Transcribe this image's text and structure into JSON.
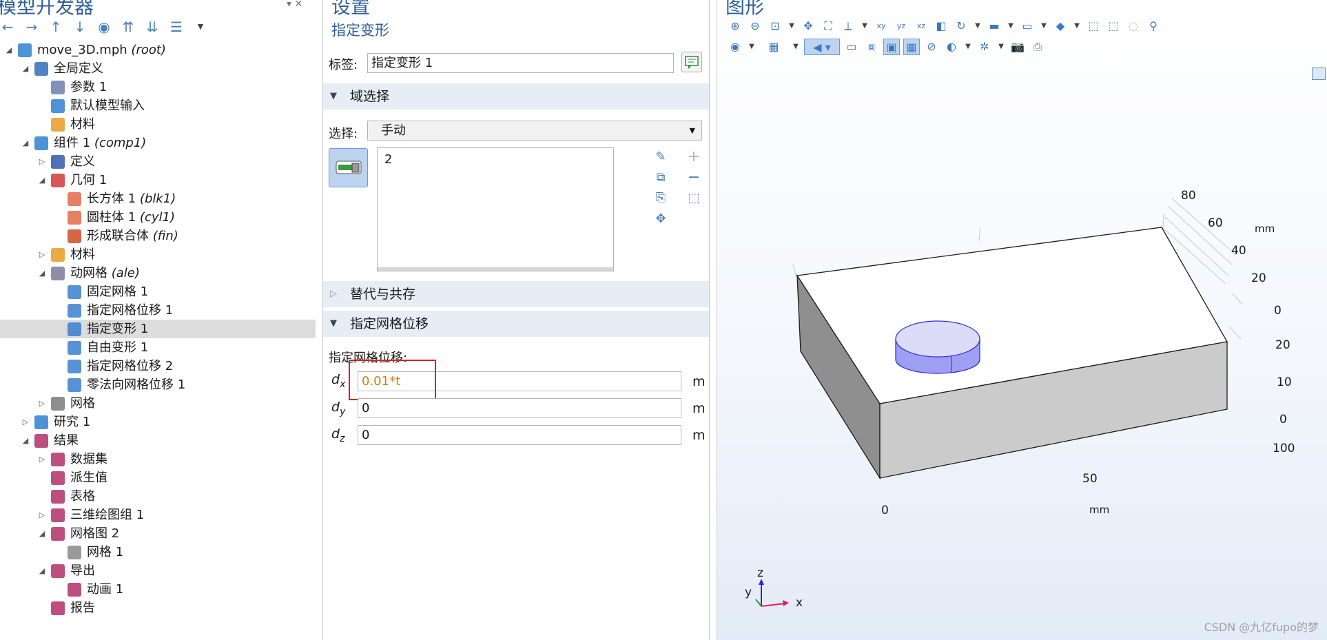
{
  "model_builder": {
    "title": "模型开发器",
    "toolbar_icons": [
      "arrow-left-icon",
      "arrow-right-icon",
      "arrow-up-icon",
      "arrow-down-icon",
      "eye-icon",
      "sort-up-icon",
      "sort-down-icon",
      "list-icon"
    ],
    "tree": [
      {
        "label": "move_3D.mph",
        "tag": "(root)",
        "level": 0,
        "toggle": "expanded",
        "icon": "root-file-icon"
      },
      {
        "label": "全局定义",
        "tag": "",
        "level": 1,
        "toggle": "expanded",
        "icon": "globe-icon"
      },
      {
        "label": "参数 1",
        "tag": "",
        "level": 2,
        "toggle": "none",
        "icon": "parameters-icon"
      },
      {
        "label": "默认模型输入",
        "tag": "",
        "level": 2,
        "toggle": "none",
        "icon": "model-input-icon"
      },
      {
        "label": "材料",
        "tag": "",
        "level": 2,
        "toggle": "none",
        "icon": "materials-icon"
      },
      {
        "label": "组件 1",
        "tag": "(comp1)",
        "level": 1,
        "toggle": "expanded",
        "icon": "component-icon"
      },
      {
        "label": "定义",
        "tag": "",
        "level": 2,
        "toggle": "collapsed",
        "icon": "definitions-icon"
      },
      {
        "label": "几何 1",
        "tag": "",
        "level": 2,
        "toggle": "expanded",
        "icon": "geometry-icon"
      },
      {
        "label": "长方体 1",
        "tag": "(blk1)",
        "level": 3,
        "toggle": "none",
        "icon": "block-icon"
      },
      {
        "label": "圆柱体 1",
        "tag": "(cyl1)",
        "level": 3,
        "toggle": "none",
        "icon": "cylinder-icon"
      },
      {
        "label": "形成联合体",
        "tag": "(fin)",
        "level": 3,
        "toggle": "none",
        "icon": "form-union-icon"
      },
      {
        "label": "材料",
        "tag": "",
        "level": 2,
        "toggle": "collapsed",
        "icon": "materials-icon"
      },
      {
        "label": "动网格",
        "tag": "(ale)",
        "level": 2,
        "toggle": "expanded",
        "icon": "moving-mesh-icon"
      },
      {
        "label": "固定网格 1",
        "tag": "",
        "level": 3,
        "toggle": "none",
        "icon": "fixed-mesh-icon"
      },
      {
        "label": "指定网格位移 1",
        "tag": "",
        "level": 3,
        "toggle": "none",
        "icon": "prescribed-mesh-displacement-icon"
      },
      {
        "label": "指定变形 1",
        "tag": "",
        "level": 3,
        "toggle": "none",
        "icon": "prescribed-deformation-icon",
        "selected": true
      },
      {
        "label": "自由变形 1",
        "tag": "",
        "level": 3,
        "toggle": "none",
        "icon": "free-deformation-icon"
      },
      {
        "label": "指定网格位移 2",
        "tag": "",
        "level": 3,
        "toggle": "none",
        "icon": "prescribed-mesh-displacement-icon"
      },
      {
        "label": "零法向网格位移 1",
        "tag": "",
        "level": 3,
        "toggle": "none",
        "icon": "zero-normal-mesh-displacement-icon"
      },
      {
        "label": "网格",
        "tag": "",
        "level": 2,
        "toggle": "collapsed",
        "icon": "mesh-icon"
      },
      {
        "label": "研究 1",
        "tag": "",
        "level": 1,
        "toggle": "collapsed",
        "icon": "study-icon"
      },
      {
        "label": "结果",
        "tag": "",
        "level": 1,
        "toggle": "expanded",
        "icon": "results-icon"
      },
      {
        "label": "数据集",
        "tag": "",
        "level": 2,
        "toggle": "collapsed",
        "icon": "datasets-icon"
      },
      {
        "label": "派生值",
        "tag": "",
        "level": 2,
        "toggle": "none",
        "icon": "derived-values-icon"
      },
      {
        "label": "表格",
        "tag": "",
        "level": 2,
        "toggle": "none",
        "icon": "tables-icon"
      },
      {
        "label": "三维绘图组 1",
        "tag": "",
        "level": 2,
        "toggle": "collapsed",
        "icon": "plot-group-3d-icon"
      },
      {
        "label": "网格图 2",
        "tag": "",
        "level": 2,
        "toggle": "expanded",
        "icon": "mesh-plot-group-icon"
      },
      {
        "label": "网格 1",
        "tag": "",
        "level": 3,
        "toggle": "none",
        "icon": "mesh-plot-icon"
      },
      {
        "label": "导出",
        "tag": "",
        "level": 2,
        "toggle": "expanded",
        "icon": "export-icon"
      },
      {
        "label": "动画 1",
        "tag": "",
        "level": 3,
        "toggle": "none",
        "icon": "animation-icon"
      },
      {
        "label": "报告",
        "tag": "",
        "level": 2,
        "toggle": "none",
        "icon": "reports-icon"
      }
    ]
  },
  "settings": {
    "title": "设置",
    "subtitle": "指定变形",
    "label_caption": "标签:",
    "label_value": "指定变形 1",
    "domain_selection": {
      "header": "域选择",
      "selection_caption": "选择:",
      "selection_value": "手动",
      "list_items": [
        "2"
      ]
    },
    "override_header": "替代与共存",
    "displacement": {
      "header": "指定网格位移",
      "caption": "指定网格位移:",
      "dx_label": "d",
      "dx_sub": "x",
      "dx_value": "0.01*t",
      "dx_unit": "m",
      "dy_label": "d",
      "dy_sub": "y",
      "dy_value": "0",
      "dy_unit": "m",
      "dz_label": "d",
      "dz_sub": "z",
      "dz_value": "0",
      "dz_unit": "m"
    },
    "highlight_color": "#d92020",
    "dx_text_color": "#c8860a"
  },
  "graphics": {
    "title": "图形",
    "axis_labels": {
      "z_ticks": [
        "80",
        "60",
        "40",
        "20",
        "0"
      ],
      "z_unit": "mm",
      "y_ticks": [
        "20",
        "10",
        "0"
      ],
      "x_ticks": [
        "0",
        "50",
        "100"
      ],
      "x_unit": "mm"
    },
    "triad": {
      "z": "z",
      "y": "y",
      "x": "x"
    },
    "watermark": "CSDN @九亿fupo的梦"
  }
}
